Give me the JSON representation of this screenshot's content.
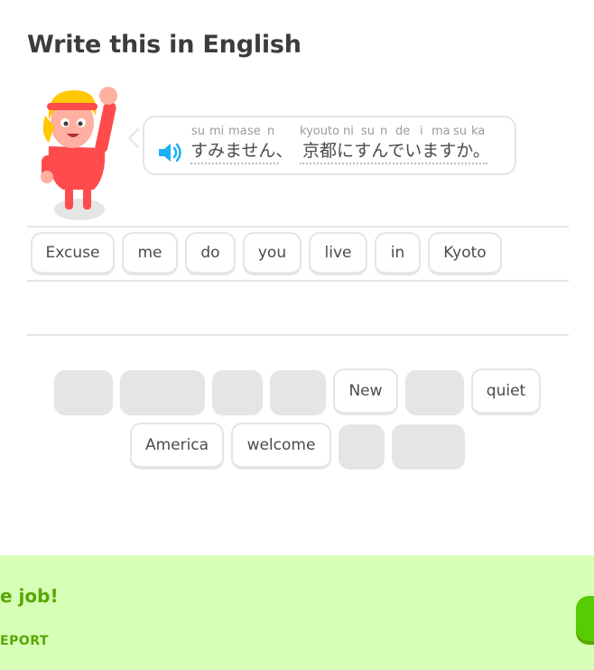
{
  "header": {
    "title": "Write this in English"
  },
  "prompt": {
    "romaji": [
      "su",
      "mi",
      "ma",
      "se",
      "n",
      "kyouto",
      "ni",
      "su",
      "n",
      "de",
      "i",
      "ma",
      "su",
      "ka"
    ],
    "japanese_part1": "すみません、",
    "japanese_part2": "京都にすんでいますか。"
  },
  "answer_tiles": [
    "Excuse",
    "me",
    "do",
    "you",
    "live",
    "in",
    "Kyoto"
  ],
  "word_bank": {
    "visible_words": [
      "New",
      "quiet",
      "America",
      "welcome"
    ]
  },
  "footer": {
    "title": "e job!",
    "report_label": "EPORT",
    "accent_color": "#58a700",
    "background_color": "#d7ffb8"
  }
}
